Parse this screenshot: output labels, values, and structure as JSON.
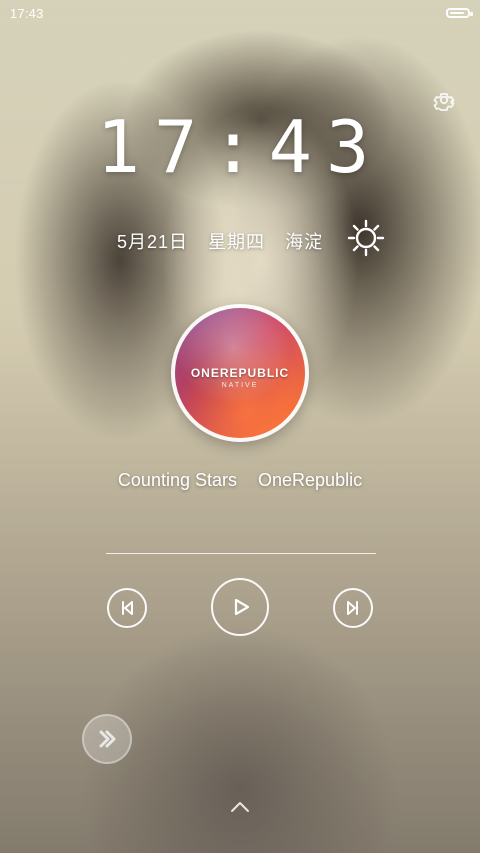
{
  "status_bar": {
    "time": "17:43",
    "battery_icon": "battery-icon"
  },
  "lockscreen": {
    "clock": "17:43",
    "date": "5月21日",
    "weekday": "星期四",
    "location": "海淀",
    "weather_icon": "sun-icon",
    "settings_icon": "gear-icon"
  },
  "music": {
    "album_art_text": "ONEREPUBLIC",
    "album_art_subtext": "NATIVE",
    "song": "Counting Stars",
    "artist": "OneRepublic",
    "controls": {
      "prev_icon": "previous-icon",
      "play_icon": "play-icon",
      "next_icon": "next-icon"
    }
  },
  "overlay": {
    "assistive_touch_icon": "assistive-touch-icon",
    "swipe_up_icon": "chevron-up-icon"
  },
  "colors": {
    "primary_text": "#ffffff"
  }
}
